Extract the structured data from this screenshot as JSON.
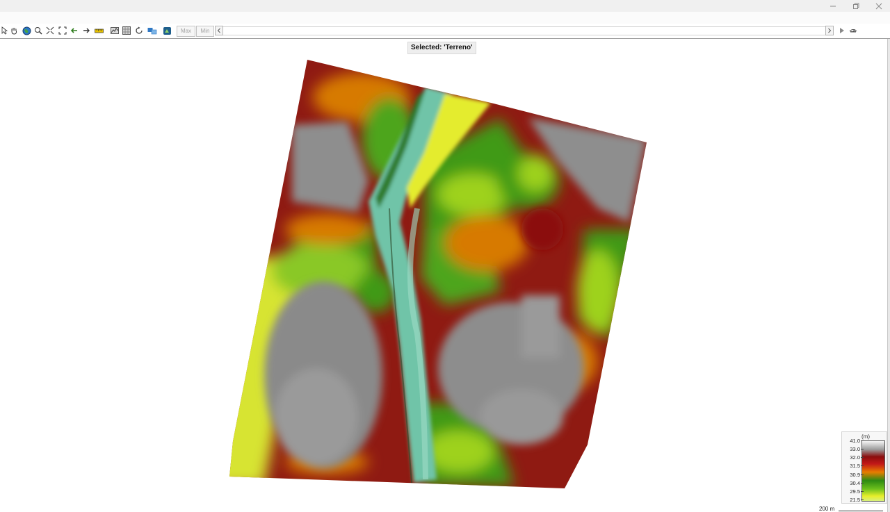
{
  "window": {
    "controls": [
      "minimize-icon",
      "restore-icon",
      "close-icon"
    ]
  },
  "toolbar": {
    "tools": [
      "pointer-icon",
      "pan-hand-icon",
      "globe-icon",
      "zoom-icon",
      "zoom-extents-icon",
      "full-extent-icon",
      "back-arrow-icon",
      "forward-arrow-icon",
      "measure-ruler-icon",
      "profile-icon",
      "grid-icon",
      "rotate-icon",
      "flow-icon",
      "3d-view-icon"
    ],
    "max_label": "Max",
    "min_label": "Min",
    "scroll_left": "◂",
    "scroll_right": "▸",
    "play_icon": "play-icon",
    "speed_icon": "speed-icon"
  },
  "view": {
    "selected_label": "Selected: 'Terreno'"
  },
  "legend": {
    "unit": "(m)",
    "ticks": [
      "41.0",
      "33.0",
      "32.0",
      "31.5",
      "30.9",
      "30.4",
      "29.5",
      "21.5"
    ],
    "colors": {
      "high": "#f4f4f4",
      "grey": "#9c9c9c",
      "dark_red": "#8b0e0e",
      "red": "#c21818",
      "orange": "#e77d00",
      "green": "#2d8a12",
      "light_green": "#6cbf1c",
      "yellow": "#e8ee2a",
      "low": "#d8f07a",
      "river": "#7fc9a8"
    }
  },
  "scale": {
    "label": "200 m"
  }
}
